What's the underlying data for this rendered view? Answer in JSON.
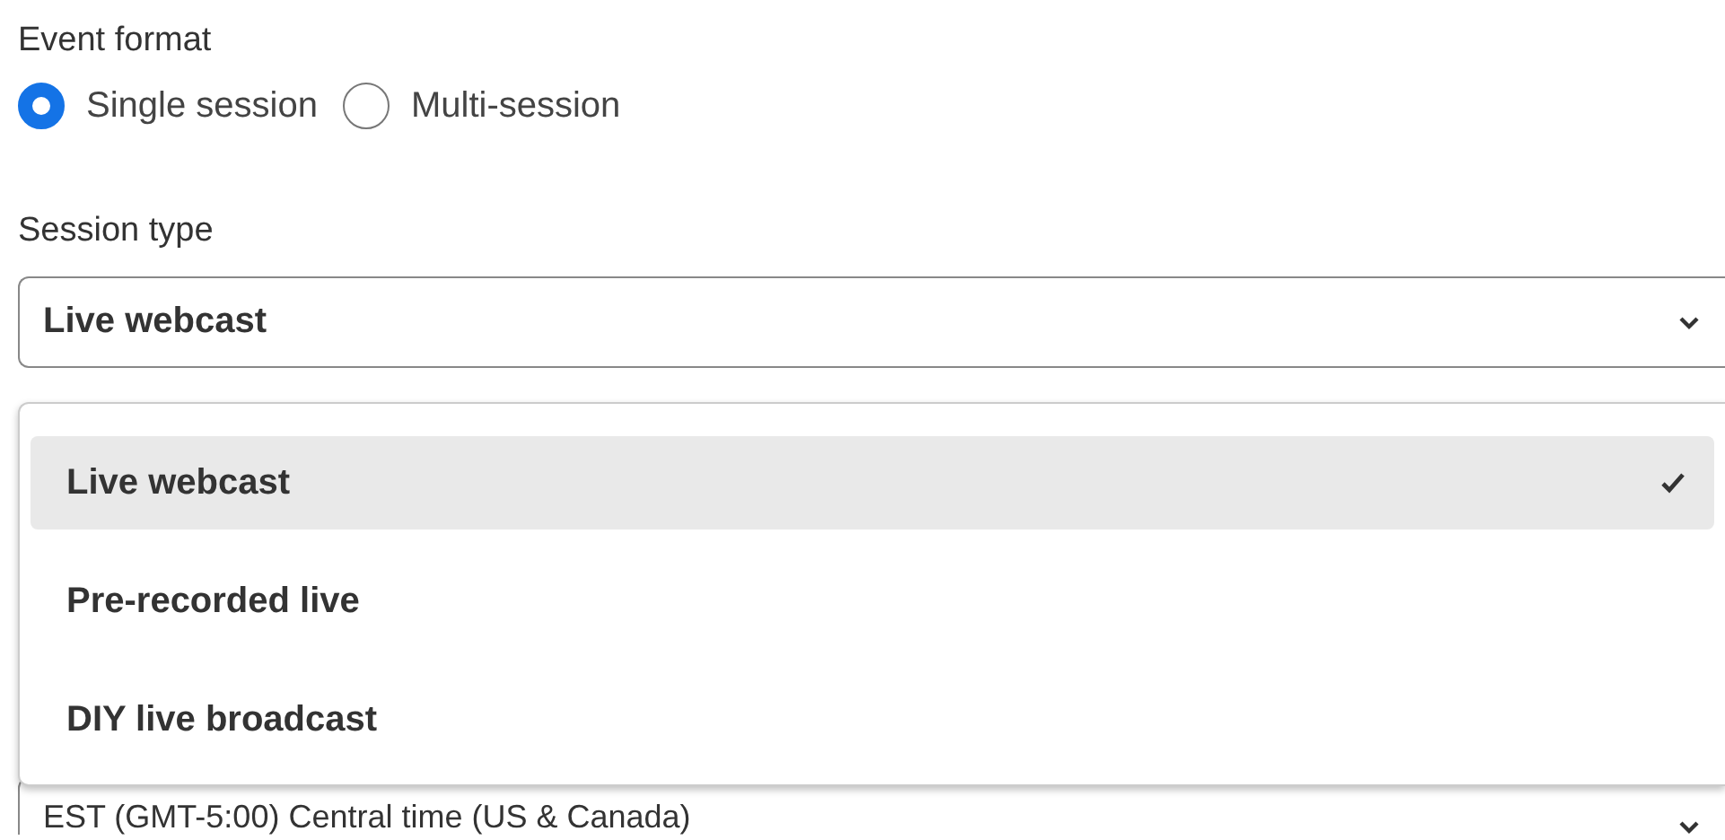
{
  "event_format": {
    "label": "Event format",
    "options": [
      {
        "label": "Single session",
        "selected": true
      },
      {
        "label": "Multi-session",
        "selected": false
      }
    ]
  },
  "session_type": {
    "label": "Session type",
    "value": "Live webcast",
    "expanded": true,
    "options": [
      {
        "label": "Live webcast",
        "selected": true
      },
      {
        "label": "Pre-recorded live",
        "selected": false
      },
      {
        "label": "DIY live broadcast",
        "selected": false
      }
    ]
  },
  "time_zone": {
    "value": "EST (GMT-5:00) Central time (US & Canada)"
  }
}
